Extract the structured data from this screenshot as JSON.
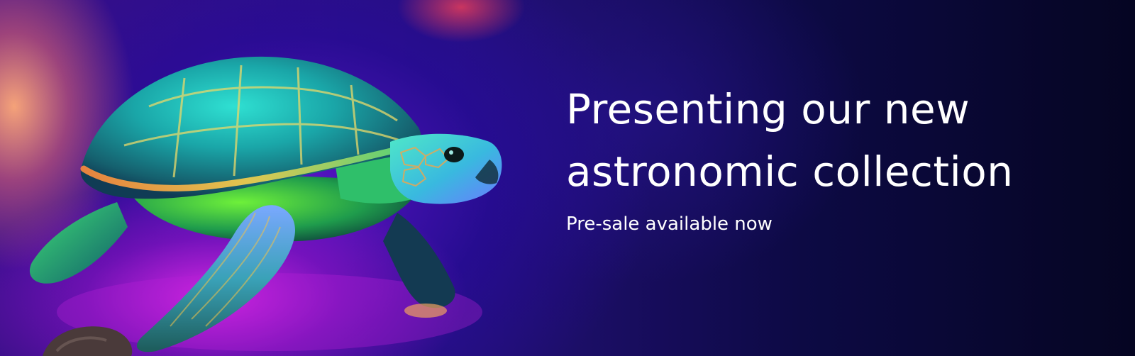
{
  "banner": {
    "headline_lines": [
      "Presenting our new",
      "astronomic collection"
    ],
    "subtitle": "Pre-sale available now"
  },
  "image": {
    "subject_icon": "turtle-illustration"
  },
  "colors": {
    "text": "#ffffff",
    "background_dark": "#07072a",
    "glow_magenta": "#dc28e6",
    "glow_violet": "#5a14c8",
    "glow_orange": "#ffaa78",
    "turtle_cyan": "#29d6d9",
    "turtle_green": "#4be25a"
  }
}
